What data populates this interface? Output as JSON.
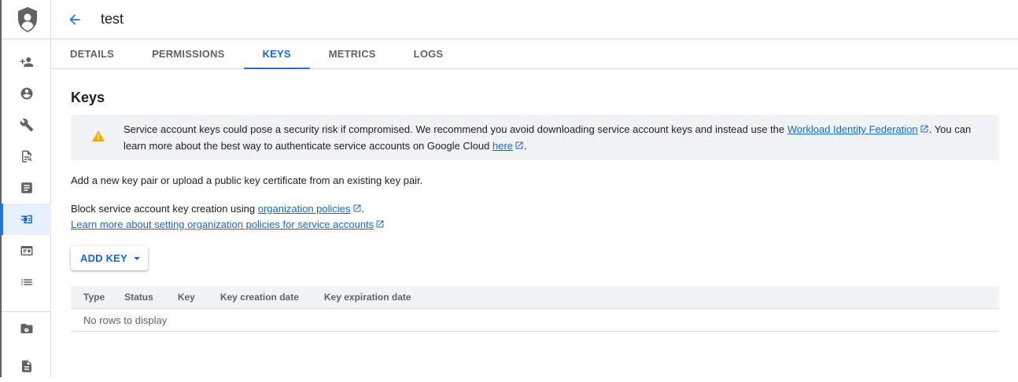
{
  "header": {
    "title": "test"
  },
  "tabs": [
    {
      "label": "DETAILS",
      "active": false
    },
    {
      "label": "PERMISSIONS",
      "active": false
    },
    {
      "label": "KEYS",
      "active": true
    },
    {
      "label": "METRICS",
      "active": false
    },
    {
      "label": "LOGS",
      "active": false
    }
  ],
  "rail": {
    "items": [
      {
        "icon": "person-add-icon"
      },
      {
        "icon": "account-circle-icon"
      },
      {
        "icon": "wrench-icon"
      },
      {
        "icon": "policy-document-icon"
      },
      {
        "icon": "article-icon"
      },
      {
        "icon": "service-account-icon",
        "active": true
      },
      {
        "icon": "id-card-icon"
      },
      {
        "icon": "list-icon"
      },
      {
        "icon": "settings-folder-icon"
      },
      {
        "icon": "document-edit-icon"
      }
    ]
  },
  "keys": {
    "title": "Keys",
    "banner": {
      "text_before": "Service account keys could pose a security risk if compromised. We recommend you avoid downloading service account keys and instead use the ",
      "link1": "Workload Identity Federation",
      "text_middle": ". You can learn more about the best way to authenticate service accounts on Google Cloud ",
      "link2": "here",
      "text_after": "."
    },
    "intro": "Add a new key pair or upload a public key certificate from an existing key pair.",
    "block_text": "Block service account key creation using ",
    "block_link": "organization policies",
    "block_after": ".",
    "learn_link": "Learn more about setting organization policies for service accounts",
    "add_key_label": "ADD KEY",
    "table": {
      "columns": [
        "Type",
        "Status",
        "Key",
        "Key creation date",
        "Key expiration date"
      ],
      "empty_message": "No rows to display"
    }
  },
  "colors": {
    "accent": "#1a73e8",
    "warning": "#f9ab00",
    "banner_bg": "#f1f3f4"
  }
}
